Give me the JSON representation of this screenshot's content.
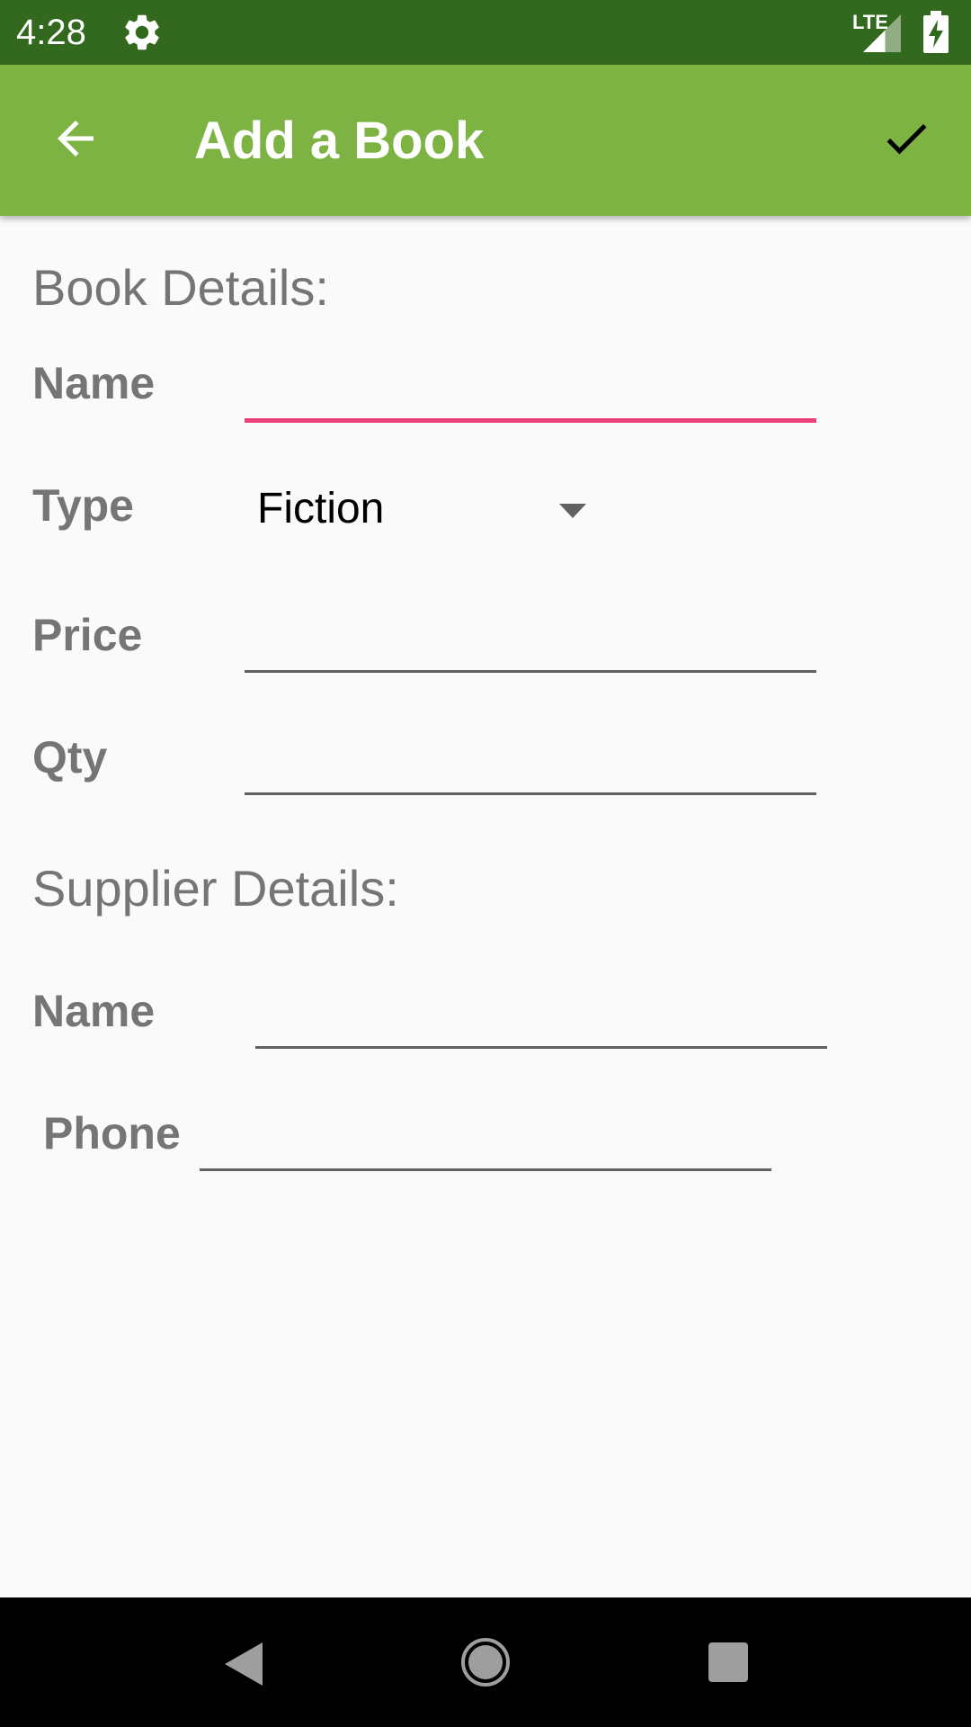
{
  "status_bar": {
    "time": "4:28",
    "network": "LTE",
    "icons": [
      "gear-icon",
      "signal-icon",
      "battery-charging-icon"
    ]
  },
  "app_bar": {
    "title": "Add a Book",
    "back_icon": "arrow-left-icon",
    "save_icon": "check-icon"
  },
  "book_details": {
    "heading": "Book Details:",
    "name_label": "Name",
    "name_value": "",
    "type_label": "Type",
    "type_selected": "Fiction",
    "price_label": "Price",
    "price_value": "",
    "qty_label": "Qty",
    "qty_value": ""
  },
  "supplier_details": {
    "heading": "Supplier Details:",
    "name_label": "Name",
    "name_value": "",
    "phone_label": "Phone",
    "phone_value": ""
  },
  "nav_bar": {
    "icons": [
      "nav-back-icon",
      "nav-home-icon",
      "nav-recents-icon"
    ]
  },
  "colors": {
    "status_bar": "#33691E",
    "app_bar": "#7CB342",
    "accent": "#EC407A",
    "label": "#757575"
  }
}
